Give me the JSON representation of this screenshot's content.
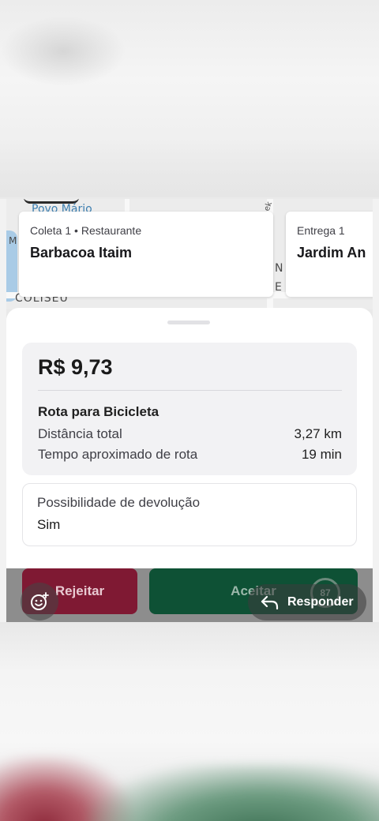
{
  "map": {
    "labels": [
      "Povo Mário",
      "M",
      "COLISEU",
      "N",
      "E",
      "ek"
    ]
  },
  "pickup": {
    "kicker_type": "Coleta 1",
    "kicker_category": "Restaurante",
    "separator": "•",
    "name": "Barbacoa Itaim"
  },
  "dropoff": {
    "kicker": "Entrega 1",
    "name": "Jardim An"
  },
  "offer": {
    "price": "R$ 9,73",
    "route_title": "Rota para Bicicleta",
    "distance_label": "Distância total",
    "distance_value": "3,27 km",
    "time_label": "Tempo aproximado de rota",
    "time_value": "19 min"
  },
  "return": {
    "label": "Possibilidade de devolução",
    "value": "Sim"
  },
  "actions": {
    "reject": "Rejeitar",
    "accept": "Aceitar",
    "timer": "87"
  },
  "overlay": {
    "reply": "Responder"
  },
  "colors": {
    "reject": "#7f1933",
    "accept": "#0e5135"
  },
  "icons": [
    "sticker-emoji-icon",
    "reply-arrow-icon"
  ]
}
